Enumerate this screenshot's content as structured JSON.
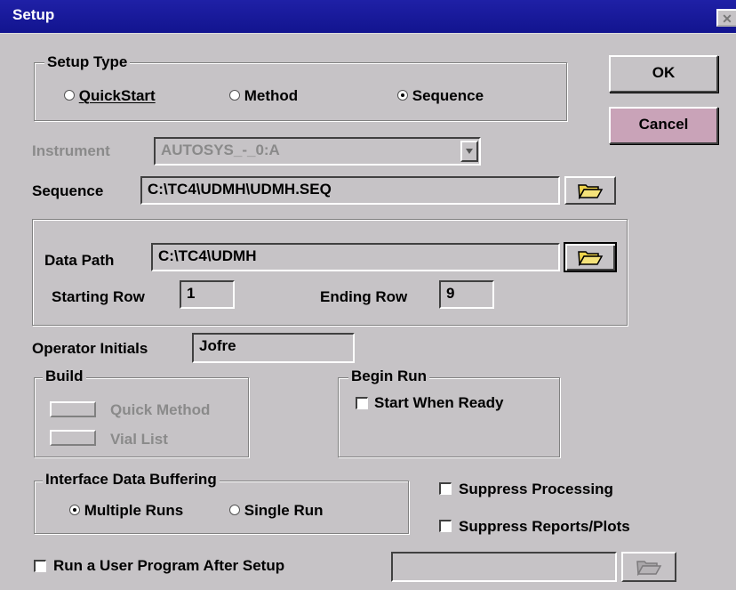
{
  "window": {
    "title": "Setup",
    "close_glyph": "✕"
  },
  "setup_type": {
    "legend": "Setup Type",
    "options": [
      {
        "label": "QuickStart",
        "selected": false
      },
      {
        "label": "Method",
        "selected": false
      },
      {
        "label": "Sequence",
        "selected": true
      }
    ]
  },
  "buttons": {
    "ok": "OK",
    "cancel": "Cancel"
  },
  "instrument": {
    "label": "Instrument",
    "value": "AUTOSYS_-_0:A",
    "dropdown_icon": "dropdown-arrow-icon"
  },
  "sequence": {
    "label": "Sequence",
    "value": "C:\\TC4\\UDMH\\UDMH.SEQ",
    "browse_icon": "folder-open-icon"
  },
  "data_path": {
    "label": "Data Path",
    "value": "C:\\TC4\\UDMH",
    "browse_icon": "folder-open-icon"
  },
  "rows": {
    "starting_label": "Starting Row",
    "starting_value": "1",
    "ending_label": "Ending Row",
    "ending_value": "9"
  },
  "operator": {
    "label": "Operator Initials",
    "value": "Jofre"
  },
  "build": {
    "legend": "Build",
    "quick_method": "Quick Method",
    "vial_list": "Vial List"
  },
  "begin_run": {
    "legend": "Begin Run",
    "start_when_ready": "Start When Ready",
    "checked": false
  },
  "buffering": {
    "legend": "Interface Data Buffering",
    "options": [
      {
        "label": "Multiple Runs",
        "selected": true
      },
      {
        "label": "Single Run",
        "selected": false
      }
    ]
  },
  "suppress": {
    "processing": "Suppress Processing",
    "reports": "Suppress Reports/Plots"
  },
  "user_program": {
    "label": "Run a User Program After Setup",
    "value": "",
    "browse_icon": "folder-open-icon"
  },
  "colors": {
    "titlebar": "#1a1c9e",
    "dialog_bg": "#c6c3c6",
    "button_accent": "#c9a3b8",
    "disabled_text": "#8a8a8a"
  }
}
